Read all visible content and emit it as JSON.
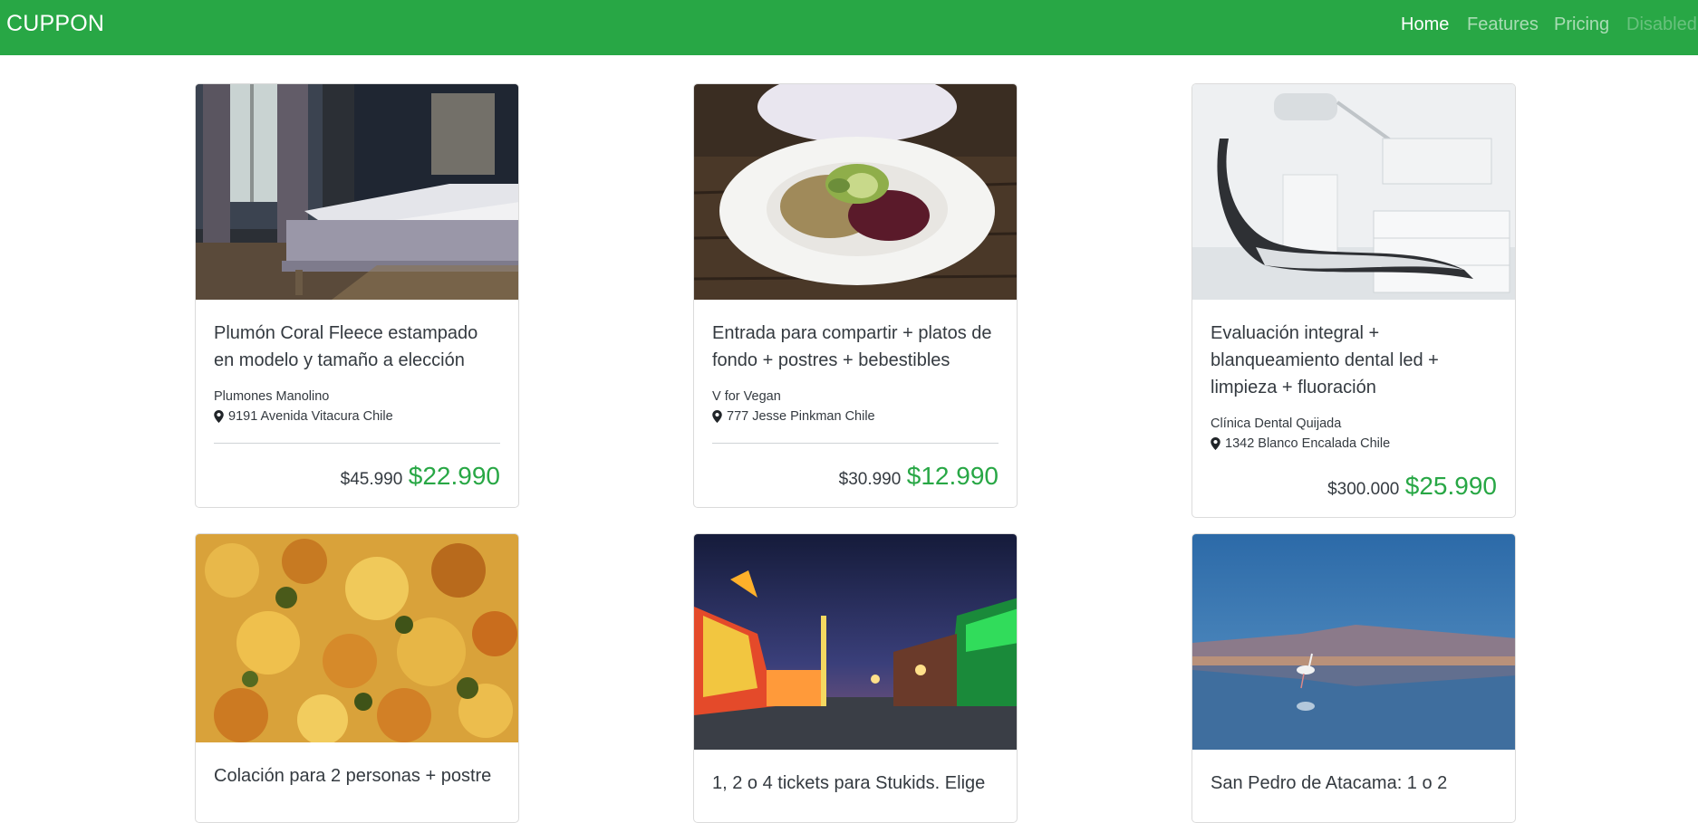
{
  "navbar": {
    "brand": "CUPPON",
    "links": [
      {
        "label": "Home",
        "state": "active"
      },
      {
        "label": "Features",
        "state": "normal"
      },
      {
        "label": "Pricing",
        "state": "normal"
      },
      {
        "label": "Disabled",
        "state": "disabled"
      }
    ]
  },
  "colors": {
    "brand": "#28a745",
    "price": "#28a745"
  },
  "cards": [
    {
      "image": "bedroom-photo",
      "title": "Plumón Coral Fleece estampado en modelo y tamaño a elección",
      "vendor": "Plumones Manolino",
      "address": "9191 Avenida Vitacura Chile",
      "old_price": "$45.990",
      "new_price": "$22.990"
    },
    {
      "image": "vegan-salad-photo",
      "title": "Entrada para compartir + platos de fondo + postres + bebestibles",
      "vendor": "V for Vegan",
      "address": "777 Jesse Pinkman Chile",
      "old_price": "$30.990",
      "new_price": "$12.990"
    },
    {
      "image": "dental-chair-photo",
      "title": "Evaluación integral + blanqueamiento dental led + limpieza + fluoración",
      "vendor": "Clínica Dental Quijada",
      "address": "1342 Blanco Encalada Chile",
      "old_price": "$300.000",
      "new_price": "$25.990"
    },
    {
      "image": "food-dish-photo",
      "title": "Colación para 2 personas + postre"
    },
    {
      "image": "fairground-night-photo",
      "title": "1, 2 o 4 tickets para Stukids. Elige"
    },
    {
      "image": "flamingo-lake-photo",
      "title": "San Pedro de Atacama: 1 o 2"
    }
  ]
}
